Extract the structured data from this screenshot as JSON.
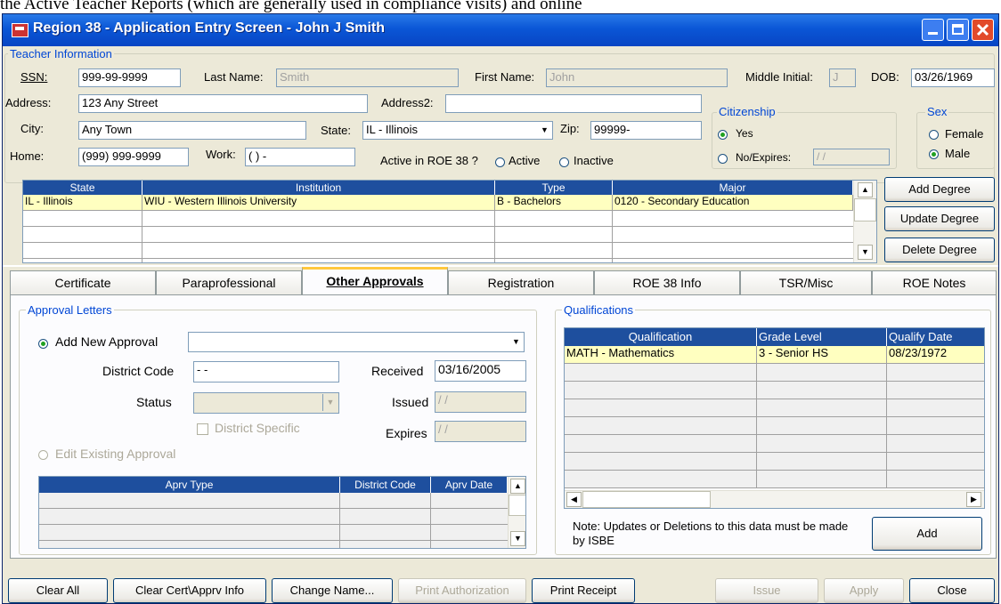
{
  "background_text": "the Active Teacher Reports (which are generally used in compliance visits) and online",
  "window": {
    "title": "Region 38 - Application Entry Screen - John J Smith",
    "accent": "#0a56d6"
  },
  "teacher": {
    "group_title": "Teacher Information",
    "ssn_label": "SSN:",
    "ssn": "999-99-9999",
    "last_name_label": "Last Name:",
    "last_name": "Smith",
    "first_name_label": "First Name:",
    "first_name": "John",
    "middle_label": "Middle Initial:",
    "middle": "J",
    "dob_label": "DOB:",
    "dob": "03/26/1969",
    "address_label": "Address:",
    "address": "123 Any Street",
    "address2_label": "Address2:",
    "address2": "",
    "city_label": "City:",
    "city": "Any Town",
    "state_label": "State:",
    "state": "IL - Illinois",
    "zip_label": "Zip:",
    "zip": "99999-",
    "home_label": "Home:",
    "home": "(999) 999-9999",
    "work_label": "Work:",
    "work": "(  )    -",
    "active_label": "Active in ROE 38 ?",
    "active_opt": "Active",
    "inactive_opt": "Inactive",
    "citizenship_title": "Citizenship",
    "cit_yes": "Yes",
    "cit_no": "No/Expires:",
    "cit_date": " /  /",
    "sex_title": "Sex",
    "sex_female": "Female",
    "sex_male": "Male"
  },
  "degrees": {
    "headers": [
      "State",
      "Institution",
      "Type",
      "Major"
    ],
    "rows": [
      [
        "IL - Illinois",
        "WIU - Western Illinois University",
        "B - Bachelors",
        "0120 - Secondary Education"
      ]
    ],
    "add": "Add Degree",
    "update": "Update Degree",
    "delete": "Delete Degree"
  },
  "tabs": [
    "Certificate",
    "Paraprofessional",
    "Other Approvals",
    "Registration",
    "ROE 38 Info",
    "TSR/Misc",
    "ROE Notes"
  ],
  "approvals": {
    "group_title": "Approval Letters",
    "add_new": "Add New Approval",
    "district_code_label": "District Code",
    "district_code": "  -   -   ",
    "received_label": "Received",
    "received": "03/16/2005",
    "status_label": "Status",
    "issued_label": "Issued",
    "issued": " /  /",
    "district_specific": "District Specific",
    "expires_label": "Expires",
    "expires": " /  /",
    "edit_existing": "Edit Existing Approval",
    "grid_headers": [
      "Aprv Type",
      "District Code",
      "Aprv Date"
    ]
  },
  "qualifications": {
    "group_title": "Qualifications",
    "headers": [
      "Qualification",
      "Grade Level",
      "Qualify Date"
    ],
    "rows": [
      [
        "MATH - Mathematics",
        "3 - Senior HS",
        "08/23/1972"
      ]
    ],
    "note": "Note:  Updates or Deletions to this data must be made by ISBE",
    "add": "Add"
  },
  "footer": {
    "clear_all": "Clear All",
    "clear_cert": "Clear Cert\\Apprv Info",
    "change_name": "Change Name...",
    "print_auth": "Print Authorization",
    "print_receipt": "Print Receipt",
    "issue": "Issue",
    "apply": "Apply",
    "close": "Close"
  }
}
